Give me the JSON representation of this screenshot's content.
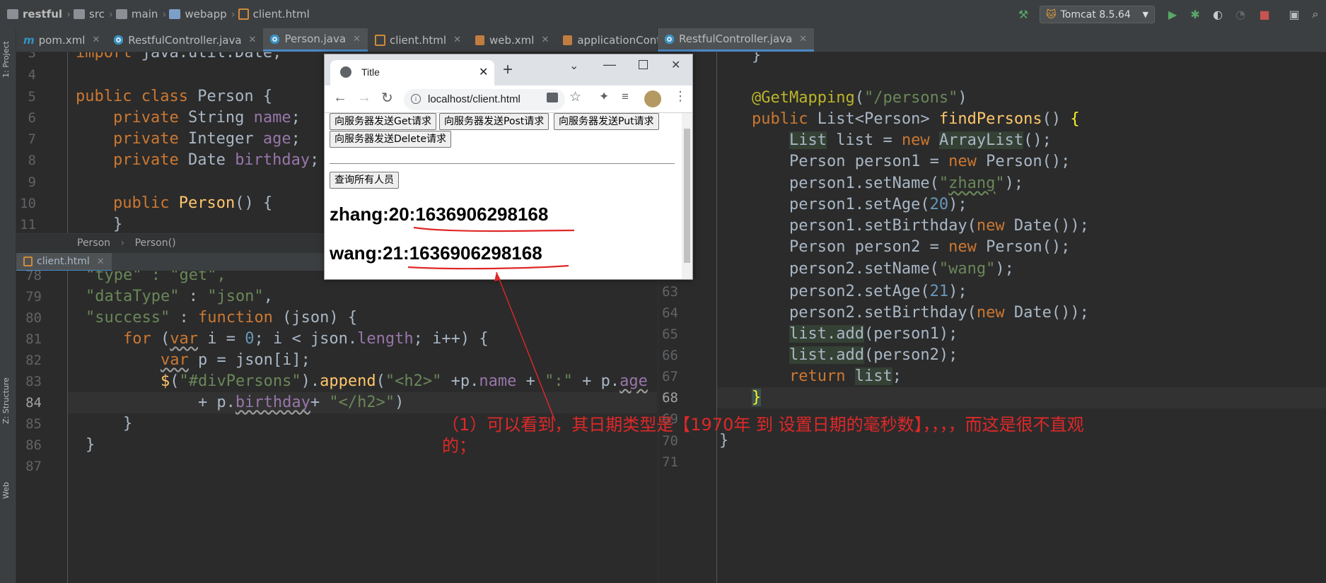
{
  "navbar": {
    "crumbs": [
      "restful",
      "src",
      "main",
      "webapp",
      "client.html"
    ],
    "run_config": "Tomcat 8.5.64"
  },
  "left_tabs": [
    {
      "label": "pom.xml",
      "icon": "maven-icon"
    },
    {
      "label": "RestfulController.java",
      "icon": "class-icon"
    },
    {
      "label": "Person.java",
      "icon": "class-icon",
      "active": true
    },
    {
      "label": "client.html",
      "icon": "html-icon"
    },
    {
      "label": "web.xml",
      "icon": "xml-icon"
    },
    {
      "label": "applicationContext.xml",
      "icon": "xml-icon"
    }
  ],
  "right_tabs": [
    {
      "label": "RestfulController.java",
      "icon": "class-icon",
      "active": true
    }
  ],
  "side_labels": {
    "project": "1: Project",
    "structure": "Z: Structure",
    "web": "Web"
  },
  "person_editor": {
    "line_numbers": [
      "3",
      "4",
      "5",
      "6",
      "7",
      "8",
      "9",
      "10",
      "11"
    ],
    "breadcrumb": [
      "Person",
      "Person()"
    ]
  },
  "client_panel": {
    "tab": "client.html",
    "line_numbers": [
      "78",
      "79",
      "80",
      "81",
      "82",
      "83",
      "84",
      "85",
      "86",
      "87"
    ]
  },
  "right_editor": {
    "line_numbers": [
      "63",
      "64",
      "65",
      "66",
      "67",
      "68",
      "69",
      "70",
      "71"
    ]
  },
  "browser": {
    "tab_title": "Title",
    "url": "localhost/client.html",
    "buttons": [
      "向服务器发送Get请求",
      "向服务器发送Post请求",
      "向服务器发送Put请求",
      "向服务器发送Delete请求"
    ],
    "query_button": "查询所有人员",
    "results": [
      {
        "prefix": "zhang:20:",
        "millis": "1636906298168"
      },
      {
        "prefix": "wang:21:",
        "millis": "1636906298168"
      }
    ]
  },
  "annotation": "（1）可以看到，其日期类型是【1970年  到  设置日期的毫秒数】，，，，而这是很不直观的；",
  "colors": {
    "background": "#2b2b2b",
    "keyword": "#cc7832",
    "string": "#6a8759",
    "annotation_red": "#e02828"
  }
}
